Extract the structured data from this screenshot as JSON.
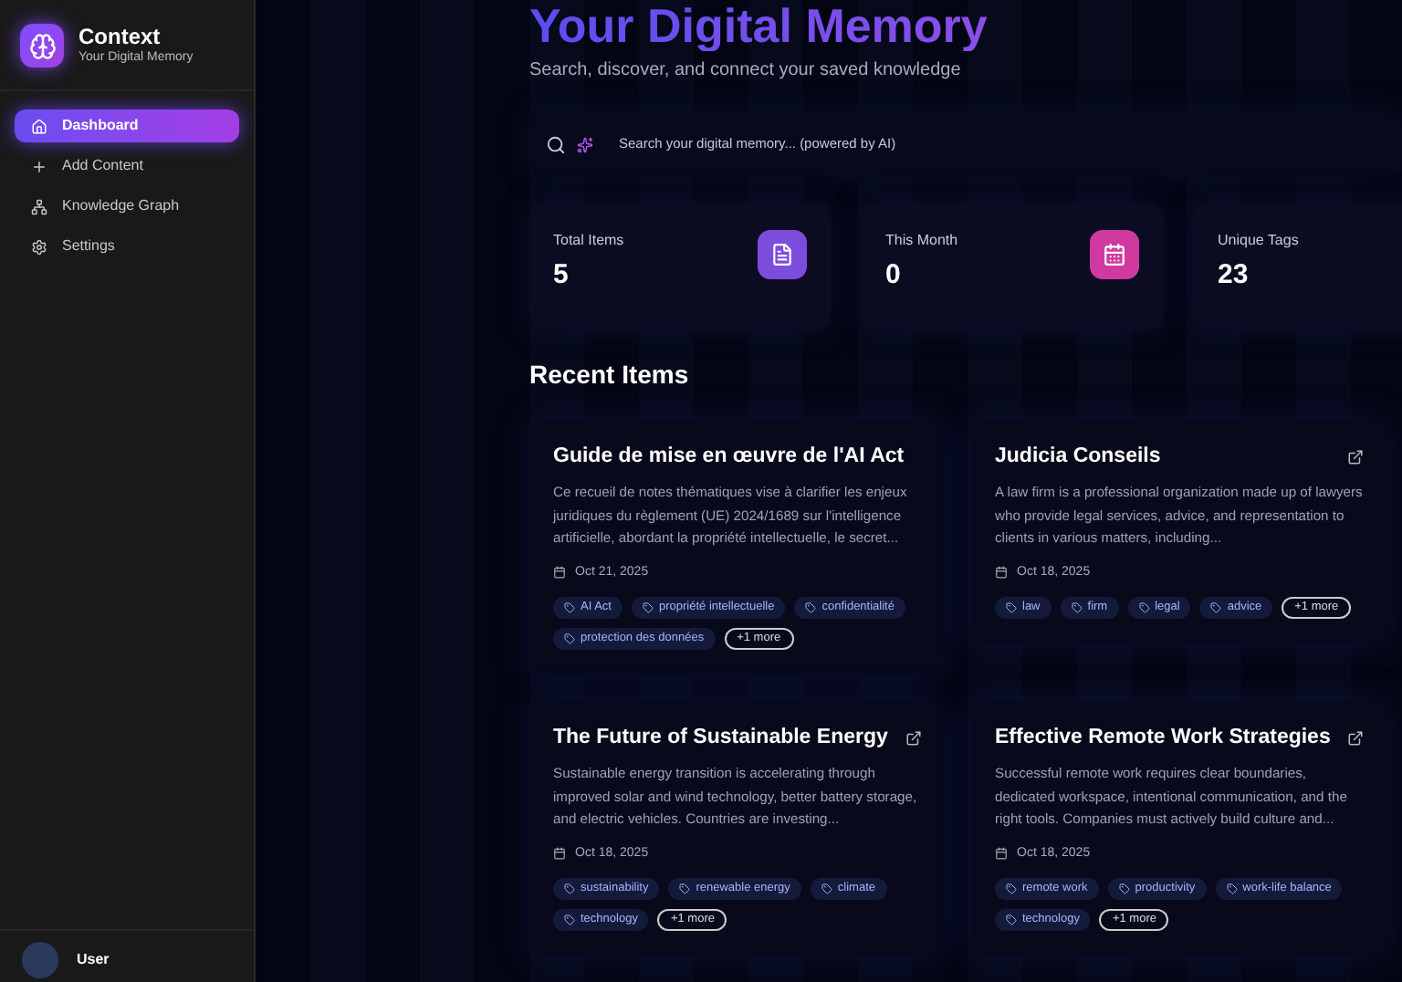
{
  "sidebar": {
    "app_name": "Context",
    "tagline": "Your Digital Memory",
    "items": [
      {
        "label": "Dashboard",
        "selected": true
      },
      {
        "label": "Add Content",
        "selected": false
      },
      {
        "label": "Knowledge Graph",
        "selected": false
      },
      {
        "label": "Settings",
        "selected": false
      }
    ],
    "user": {
      "name": "User"
    }
  },
  "header": {
    "title": "Your Digital Memory",
    "subtitle": "Search, discover, and connect your saved knowledge"
  },
  "search": {
    "placeholder": "Search your digital memory... (powered by AI)"
  },
  "stats": [
    {
      "label": "Total Items",
      "value": "5",
      "color": "#7c4ddc"
    },
    {
      "label": "This Month",
      "value": "0",
      "color": "#d03aa0"
    },
    {
      "label": "Unique Tags",
      "value": "23"
    }
  ],
  "recent": {
    "heading": "Recent Items",
    "items": [
      {
        "title": "Guide de mise en œuvre de l'AI Act",
        "description": "Ce recueil de notes thématiques vise à clarifier les enjeux juridiques du règlement (UE) 2024/1689 sur l'intelligence artificielle, abordant la propriété intellectuelle, le secret...",
        "date": "Oct 21, 2025",
        "external_link": false,
        "tags": [
          "AI Act",
          "propriété intellectuelle",
          "confidentialité",
          "protection des données"
        ],
        "more": "+1 more"
      },
      {
        "title": "Judicia Conseils",
        "description": "A law firm is a professional organization made up of lawyers who provide legal services, advice, and representation to clients in various matters, including...",
        "date": "Oct 18, 2025",
        "external_link": true,
        "tags": [
          "law",
          "firm",
          "legal",
          "advice"
        ],
        "more": "+1 more"
      },
      {
        "title": "The Future of Sustainable Energy",
        "description": "Sustainable energy transition is accelerating through improved solar and wind technology, better battery storage, and electric vehicles. Countries are investing...",
        "date": "Oct 18, 2025",
        "external_link": true,
        "tags": [
          "sustainability",
          "renewable energy",
          "climate",
          "technology"
        ],
        "more": "+1 more"
      },
      {
        "title": "Effective Remote Work Strategies",
        "description": "Successful remote work requires clear boundaries, dedicated workspace, intentional communication, and the right tools. Companies must actively build culture and...",
        "date": "Oct 18, 2025",
        "external_link": true,
        "tags": [
          "remote work",
          "productivity",
          "work-life balance",
          "technology"
        ],
        "more": "+1 more"
      }
    ]
  }
}
